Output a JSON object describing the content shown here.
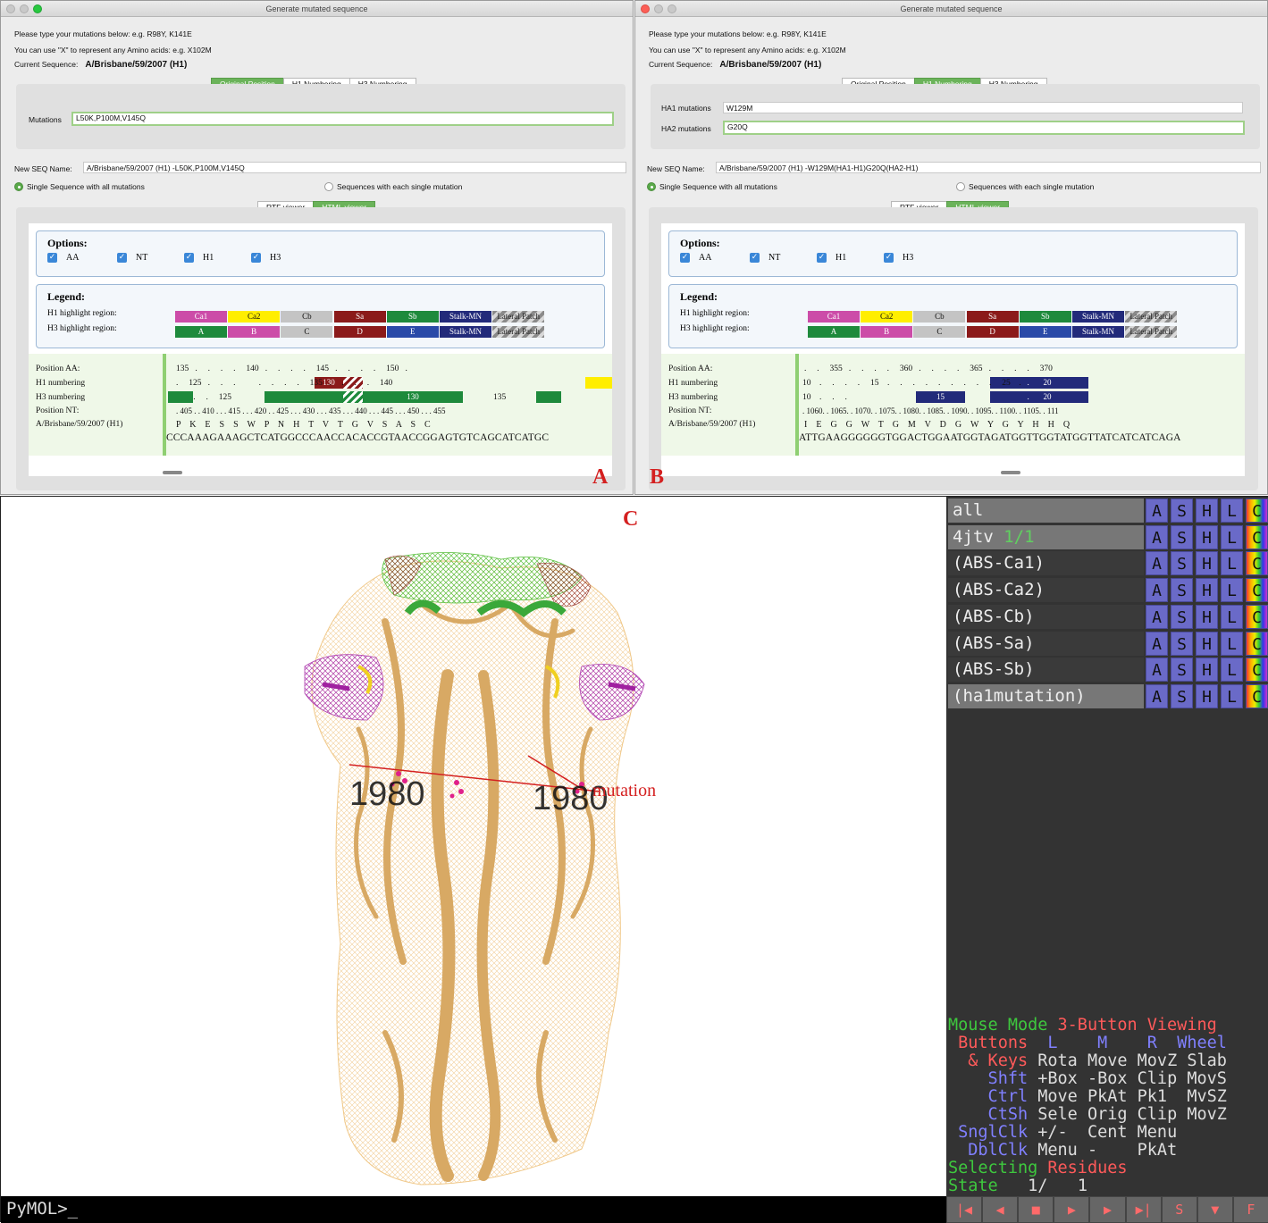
{
  "window_title": "Generate mutated sequence",
  "help_line1": "Please type your mutations below: e.g. R98Y, K141E",
  "help_line2": "You can use \"X\" to represent any Amino acids: e.g. X102M",
  "current_seq_label": "Current Sequence:",
  "current_seq": "A/Brisbane/59/2007 (H1)",
  "numbering_tabs": [
    "Original Position",
    "H1 Numbering",
    "H3 Numbering"
  ],
  "viewer_tabs": [
    "RTF viewer",
    "HTML viewer"
  ],
  "new_seq_label": "New SEQ Name:",
  "radio_single": "Single Sequence with all mutations",
  "radio_each": "Sequences with each single mutation",
  "options_title": "Options:",
  "options": [
    "AA",
    "NT",
    "H1",
    "H3"
  ],
  "legend_title": "Legend:",
  "h1_region_label": "H1 highlight region:",
  "h3_region_label": "H3 highlight region:",
  "h1_regions": [
    {
      "label": "Ca1",
      "color": "#cc4ca8",
      "text": "#ffffff"
    },
    {
      "label": "Ca2",
      "color": "#ffee00",
      "text": "#111111"
    },
    {
      "label": "Cb",
      "color": "#c4c4c4",
      "text": "#111111"
    },
    {
      "label": "Sa",
      "color": "#8b1a1a",
      "text": "#ffffff"
    },
    {
      "label": "Sb",
      "color": "#1e8a3c",
      "text": "#ffffff"
    },
    {
      "label": "Stalk-MN",
      "color": "#222a7a",
      "text": "#ffffff"
    },
    {
      "label": "Lateral Patch",
      "color": "#8a8a8a",
      "text": "#222222"
    }
  ],
  "h3_regions": [
    {
      "label": "A",
      "color": "#1e8a3c",
      "text": "#ffffff"
    },
    {
      "label": "B",
      "color": "#cc4ca8",
      "text": "#ffffff"
    },
    {
      "label": "C",
      "color": "#c4c4c4",
      "text": "#111111"
    },
    {
      "label": "D",
      "color": "#8b1a1a",
      "text": "#ffffff"
    },
    {
      "label": "E",
      "color": "#2a4aa8",
      "text": "#ffffff"
    },
    {
      "label": "Stalk-MN",
      "color": "#222a7a",
      "text": "#ffffff"
    },
    {
      "label": "Lateral Patch",
      "color": "#8a8a8a",
      "text": "#222222"
    }
  ],
  "row_labels": [
    "Position AA:",
    "H1 numbering",
    "H3 numbering",
    "Position NT:",
    "A/Brisbane/59/2007 (H1)"
  ],
  "panelA": {
    "letter": "A",
    "mutations_label": "Mutations",
    "mutations_value": "L50K,P100M,V145Q",
    "new_seq_value": "A/Brisbane/59/2007 (H1)  -L50K,P100M,V145Q",
    "pos_aa": "135   .     .     .     .     140   .     .     .     .     145   .     .     .     .     150   .",
    "h1_num": ".     125   .     .     .           .     .     .     .     135   .     .     .     .     140",
    "h3_num": "      .     .     125",
    "h3_130": "130",
    "h1_130": "130",
    "h3_135": "135",
    "pos_nt": ". 405 . . 410 . . . 415 . . . 420 . . 425 . . . 430 . . . 435 . . . 440 . . . 445 . . . 450 . . . 455",
    "aa_seq": "P    K    E    S    S    W    P    N    H    T    V    T    G    V    S    A    S    C",
    "nt_seq": "CCCAAAGAAAGCTCATGGCCCAACCACACCGTAACCGGAGTGTCAGCATCATGC"
  },
  "panelB": {
    "letter": "B",
    "ha1_label": "HA1 mutations",
    "ha1_value": "W129M",
    "ha2_label": "HA2 mutations",
    "ha2_value": "G20Q",
    "new_seq_value": "A/Brisbane/59/2007 (H1)  -W129M(HA1-H1)G20Q(HA2-H1)",
    "pos_aa": ".     .     355   .     .     .     .     360   .     .     .     .     365   .     .     .     .     370",
    "h1_num": "10    .     .     .     .     15    .     .     .     .     .     .     .     .     .     25    .",
    "h3_num": "10    .     .     .",
    "h1_20": ".       20",
    "h3_15": "15",
    "h3_20": ".       20",
    "pos_nt": ". 1060. . 1065. . 1070. . 1075. . 1080. . 1085. . 1090. . 1095. . 1100. . 1105. . 111",
    "aa_seq": "I    E    G    G    W    T    G    M    V    D    G    W    Y    G    Y    H    H    Q",
    "nt_seq": "ATTGAAGGGGGGTGGACTGGAATGGTAGATGGTTGGTATGGTTATCATCATCAGA"
  },
  "panelC_letter": "C",
  "mutation_label": "mutation",
  "residue_labels": [
    "1980",
    "1980"
  ],
  "pymol": {
    "objects": [
      {
        "name": "all",
        "state": ""
      },
      {
        "name": "4jtv",
        "state": "1/1"
      },
      {
        "name": "(ABS-Ca1)",
        "state": ""
      },
      {
        "name": "(ABS-Ca2)",
        "state": ""
      },
      {
        "name": "(ABS-Cb)",
        "state": ""
      },
      {
        "name": "(ABS-Sa)",
        "state": ""
      },
      {
        "name": "(ABS-Sb)",
        "state": ""
      },
      {
        "name": "(ha1mutation)",
        "state": ""
      }
    ],
    "obj_buttons": [
      "A",
      "S",
      "H",
      "L",
      "C"
    ],
    "mouse_mode": "Mouse Mode",
    "mode_name": "3-Button Viewing",
    "buttons_label": "Buttons",
    "btn_cols": [
      "L",
      "M",
      "R",
      "Wheel"
    ],
    "keys_label": "& Keys",
    "rows": [
      {
        "key": "",
        "vals": [
          "Rota",
          "Move",
          "MovZ",
          "Slab"
        ]
      },
      {
        "key": "Shft",
        "vals": [
          "+Box",
          "-Box",
          "Clip",
          "MovS"
        ]
      },
      {
        "key": "Ctrl",
        "vals": [
          "Move",
          "PkAt",
          "Pk1",
          "MvSZ"
        ]
      },
      {
        "key": "CtSh",
        "vals": [
          "Sele",
          "Orig",
          "Clip",
          "MovZ"
        ]
      },
      {
        "key": "SnglClk",
        "vals": [
          "+/-",
          "Cent",
          "Menu",
          ""
        ]
      },
      {
        "key": "DblClk",
        "vals": [
          "Menu",
          "-",
          "PkAt",
          ""
        ]
      }
    ],
    "selecting": "Selecting",
    "selecting_what": "Residues",
    "state_label": "State",
    "state_val": "1/",
    "state_max": "1",
    "prompt": "PyMOL>_",
    "nav_buttons": [
      "|◀",
      "◀",
      "■",
      "▶",
      "▶",
      "▶|",
      "S",
      "▼",
      "F"
    ]
  }
}
